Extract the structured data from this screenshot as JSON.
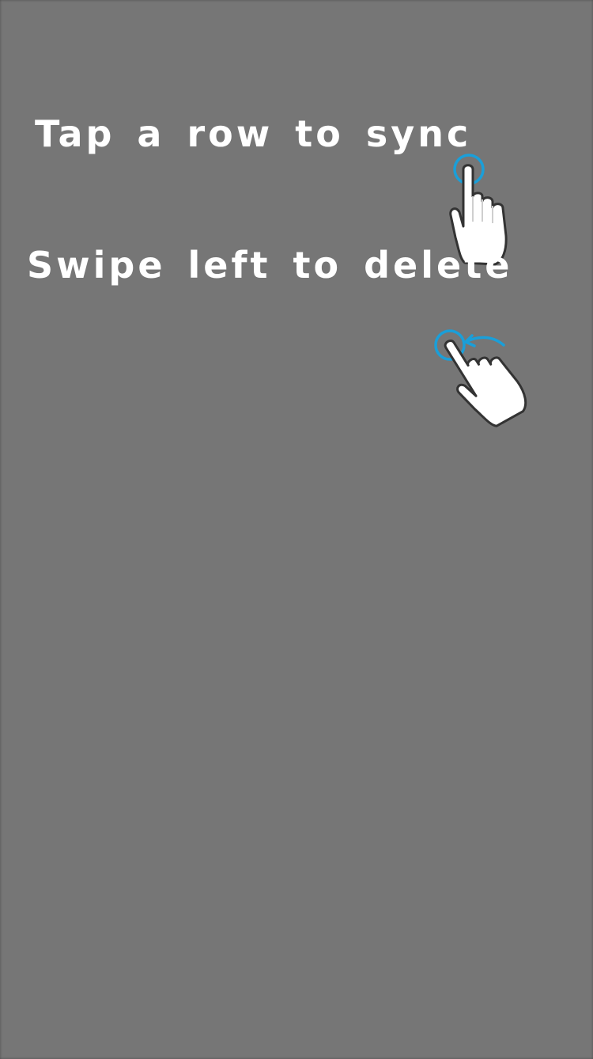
{
  "hints": {
    "tap": {
      "text": "Tap a row to sync",
      "icon": "tap-gesture-icon"
    },
    "swipe": {
      "text": "Swipe left to delete",
      "icon": "swipe-left-gesture-icon"
    }
  },
  "colors": {
    "overlay_background": "#767676",
    "text": "#ffffff",
    "gesture_accent": "#1a9fd9",
    "hand_fill": "#ffffff",
    "hand_outline": "#333333"
  }
}
